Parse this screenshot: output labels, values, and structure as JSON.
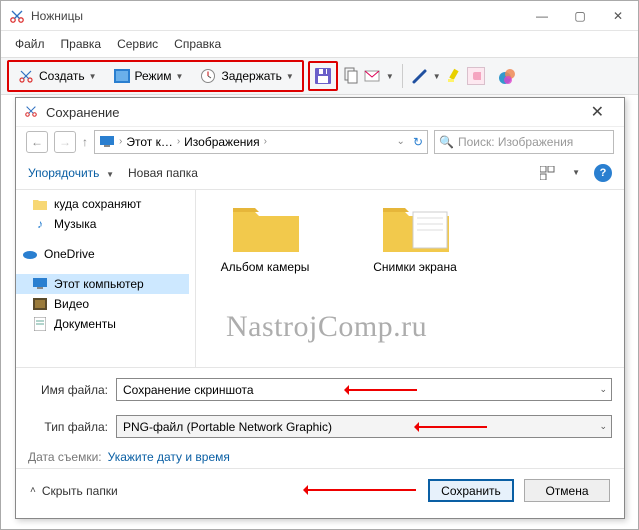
{
  "app": {
    "title": "Ножницы"
  },
  "menubar": {
    "items": [
      "Файл",
      "Правка",
      "Сервис",
      "Справка"
    ]
  },
  "toolbar": {
    "create": "Создать",
    "mode": "Режим",
    "delay": "Задержать"
  },
  "dialog": {
    "title": "Сохранение",
    "breadcrumb": {
      "seg1": "Этот к…",
      "seg2": "Изображения"
    },
    "search": {
      "placeholder": "Поиск: Изображения"
    },
    "organize": "Упорядочить",
    "new_folder": "Новая папка",
    "tree": {
      "items": [
        {
          "icon": "folder",
          "label": "куда сохраняют"
        },
        {
          "icon": "music",
          "label": "Музыка"
        },
        {
          "icon": "onedrive",
          "label": "OneDrive"
        },
        {
          "icon": "thispc",
          "label": "Этот компьютер"
        },
        {
          "icon": "video",
          "label": "Видео"
        },
        {
          "icon": "docs",
          "label": "Документы"
        }
      ]
    },
    "folders": [
      {
        "label": "Альбом камеры"
      },
      {
        "label": "Снимки экрана"
      }
    ],
    "watermark": "NastrojComp.ru",
    "filename_label": "Имя файла:",
    "filename_value": "Сохранение скриншота",
    "filetype_label": "Тип файла:",
    "filetype_value": "PNG-файл (Portable Network Graphic)",
    "date_label": "Дата съемки:",
    "date_value": "Укажите дату и время",
    "hide_folders": "Скрыть папки",
    "save_btn": "Сохранить",
    "cancel_btn": "Отмена"
  }
}
